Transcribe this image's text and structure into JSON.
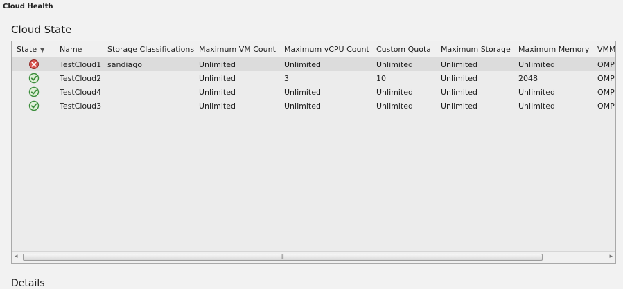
{
  "window": {
    "title": "Cloud Health"
  },
  "section": {
    "title": "Cloud State"
  },
  "grid": {
    "columns": [
      "State",
      "Name",
      "Storage Classifications",
      "Maximum VM Count",
      "Maximum vCPU Count",
      "Custom Quota",
      "Maximum Storage",
      "Maximum Memory",
      "VMM"
    ],
    "rows": [
      {
        "state": "error",
        "name": "TestCloud1",
        "storage": "sandiago",
        "maxvm": "Unlimited",
        "maxvcpu": "Unlimited",
        "quota": "Unlimited",
        "storagemax": "Unlimited",
        "memory": "Unlimited",
        "vmm": "OMP"
      },
      {
        "state": "ok",
        "name": "TestCloud2",
        "storage": "",
        "maxvm": "Unlimited",
        "maxvcpu": "3",
        "quota": "10",
        "storagemax": "Unlimited",
        "memory": "2048",
        "vmm": "OMP"
      },
      {
        "state": "ok",
        "name": "TestCloud4",
        "storage": "",
        "maxvm": "Unlimited",
        "maxvcpu": "Unlimited",
        "quota": "Unlimited",
        "storagemax": "Unlimited",
        "memory": "Unlimited",
        "vmm": "OMP"
      },
      {
        "state": "ok",
        "name": "TestCloud3",
        "storage": "",
        "maxvm": "Unlimited",
        "maxvcpu": "Unlimited",
        "quota": "Unlimited",
        "storagemax": "Unlimited",
        "memory": "Unlimited",
        "vmm": "OMP"
      }
    ],
    "selected_row": 0
  },
  "icons": {
    "error": "error-icon",
    "ok": "ok-check-icon",
    "sort": "sort-desc-icon",
    "scroll_left": "scroll-left-icon",
    "scroll_right": "scroll-right-icon"
  },
  "colors": {
    "error_red": "#d9534f",
    "ok_green": "#5cb85c",
    "selection": "#dcdcdc"
  },
  "footer": {
    "partial_label": "Details"
  }
}
